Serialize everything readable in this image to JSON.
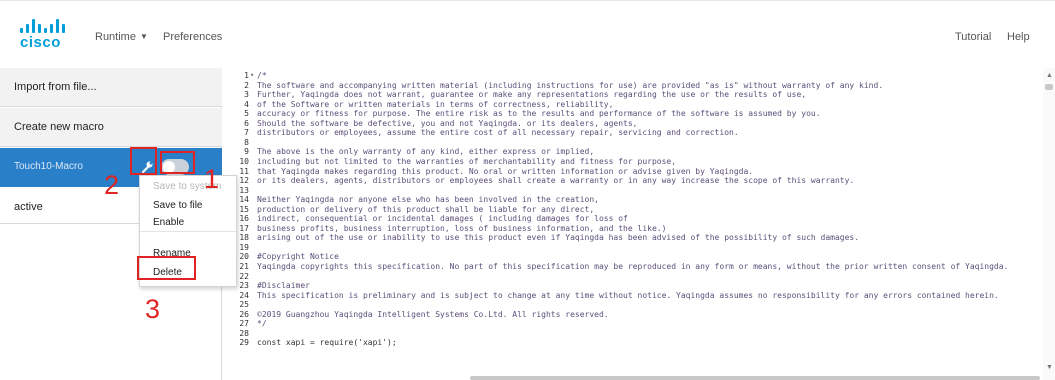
{
  "header": {
    "logo_text": "cisco",
    "runtime_label": "Runtime",
    "preferences_label": "Preferences",
    "tutorial_label": "Tutorial",
    "help_label": "Help",
    "brand_color": "#049fd9"
  },
  "sidebar": {
    "import_label": "Import from file...",
    "create_label": "Create new macro",
    "macro_name": "Touch10-Macro",
    "active_label": "active",
    "active_color": "#2a7fc9"
  },
  "context_menu": {
    "save_to_system": "Save to system",
    "save_to_file": "Save to file",
    "enable": "Enable",
    "rename": "Rename",
    "delete": "Delete"
  },
  "annotations": {
    "n1": "1",
    "n2": "2",
    "n3": "3",
    "color": "#e02424"
  },
  "editor": {
    "lines": [
      {
        "n": "1",
        "t": "/*",
        "fold": true
      },
      {
        "n": "2",
        "t": "The software and accompanying written material (including instructions for use) are provided \"as is\" without warranty of any kind."
      },
      {
        "n": "3",
        "t": "Further, Yaqingda does not warrant, guarantee or make any representations regarding the use or the results of use,"
      },
      {
        "n": "4",
        "t": "of the Software or written materials in terms of correctness, reliability,"
      },
      {
        "n": "5",
        "t": "accuracy or fitness for purpose. The entire risk as to the results and performance of the software is assumed by you."
      },
      {
        "n": "6",
        "t": "Should the software be defective, you and not Yaqingda. or its dealers, agents,"
      },
      {
        "n": "7",
        "t": "distributors or employees, assume the entire cost of all necessary repair, servicing and correction."
      },
      {
        "n": "8",
        "t": ""
      },
      {
        "n": "9",
        "t": "The above is the only warranty of any kind, either express or implied,"
      },
      {
        "n": "10",
        "t": "including but not limited to the warranties of merchantability and fitness for purpose,"
      },
      {
        "n": "11",
        "t": "that Yaqingda makes regarding this product. No oral or written information or advise given by Yaqingda."
      },
      {
        "n": "12",
        "t": "or its dealers, agents, distributors or employees shall create a warranty or in any way increase the scope of this warranty."
      },
      {
        "n": "13",
        "t": ""
      },
      {
        "n": "14",
        "t": "Neither Yaqingda nor anyone else who has been involved in the creation,"
      },
      {
        "n": "15",
        "t": "production or delivery of this product shall be liable for any direct,"
      },
      {
        "n": "16",
        "t": "indirect, consequential or incidental damages ( including damages for loss of"
      },
      {
        "n": "17",
        "t": "business profits, business interruption, loss of business information, and the like.)"
      },
      {
        "n": "18",
        "t": "arising out of the use or inability to use this product even if Yaqingda has been advised of the possibility of such damages."
      },
      {
        "n": "19",
        "t": ""
      },
      {
        "n": "20",
        "t": "#Copyright Notice"
      },
      {
        "n": "21",
        "t": "Yaqingda copyrights this specification. No part of this specification may be reproduced in any form or means, without the prior written consent of Yaqingda."
      },
      {
        "n": "22",
        "t": ""
      },
      {
        "n": "23",
        "t": "#Disclaimer"
      },
      {
        "n": "24",
        "t": "This specification is preliminary and is subject to change at any time without notice. Yaqingda assumes no responsibility for any errors contained herein."
      },
      {
        "n": "25",
        "t": ""
      },
      {
        "n": "26",
        "t": "©2019 Guangzhou Yaqingda Intelligent Systems Co.Ltd. All rights reserved."
      },
      {
        "n": "27",
        "t": "*/"
      },
      {
        "n": "28",
        "t": ""
      },
      {
        "n": "29",
        "t": "const xapi = require('xapi');"
      }
    ]
  }
}
